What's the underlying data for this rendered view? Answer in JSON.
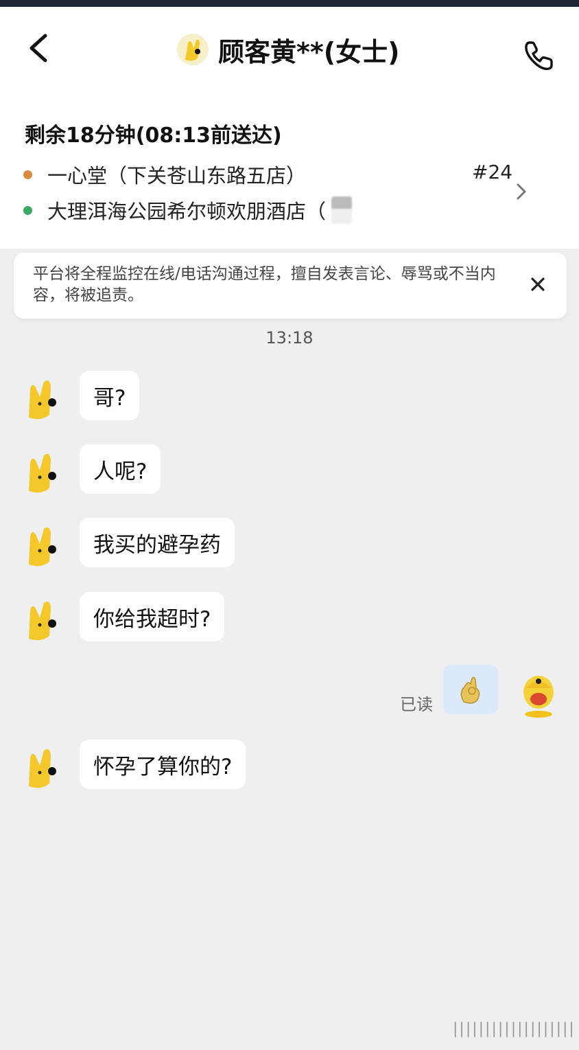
{
  "header": {
    "title": "顾客黄**(女士)"
  },
  "order": {
    "eta": "剩余18分钟(08:13前送达)",
    "order_no": "#24",
    "stops": [
      {
        "name": "一心堂（下关苍山东路五店）",
        "dot_color": "#d98a3c"
      },
      {
        "name": "大理洱海公园希尔顿欢朋酒店（",
        "dot_color": "#3aa765"
      }
    ]
  },
  "notice": {
    "text": "平台将全程监控在线/电话沟通过程，擅自发表言论、辱骂或不当内容，将被追责。"
  },
  "chat": {
    "timestamp": "13:18",
    "messages": [
      {
        "text": "哥?"
      },
      {
        "text": "人呢?"
      },
      {
        "text": "我买的避孕药"
      },
      {
        "text": "你给我超时?"
      },
      {
        "text": "怀孕了算你的?"
      }
    ],
    "read_label": "已读",
    "my_sticker": "ok-hand-sticker"
  },
  "footer": {
    "watermark": "|||||||||||||||||||"
  },
  "colors": {
    "bubble": "#ffffff",
    "my_bubble": "#dce9fb",
    "background": "#efefef"
  }
}
